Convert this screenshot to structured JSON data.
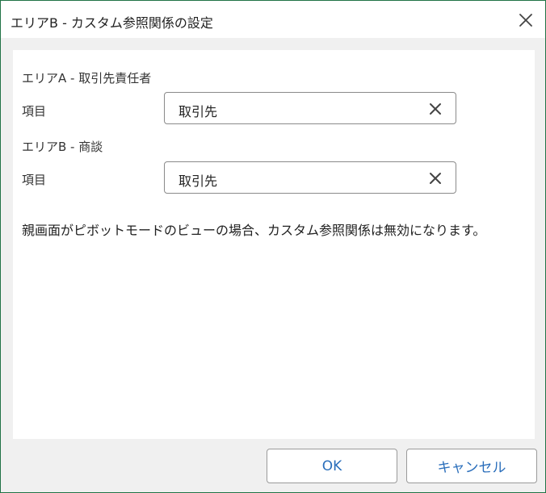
{
  "dialog": {
    "title": "エリアB - カスタム参照関係の設定",
    "close_icon": "close-icon"
  },
  "area_a": {
    "heading": "エリアA - 取引先責任者",
    "field_label": "項目",
    "field_value": "取引先",
    "clear_icon": "clear-icon"
  },
  "area_b": {
    "heading": "エリアB - 商談",
    "field_label": "項目",
    "field_value": "取引先",
    "clear_icon": "clear-icon"
  },
  "note": "親画面がピボットモードのビューの場合、カスタム参照関係は無効になります。",
  "buttons": {
    "ok": "OK",
    "cancel": "キャンセル"
  },
  "colors": {
    "window_border": "#217346",
    "button_text": "#2a6ebb",
    "dialog_background": "#f0f0f0"
  }
}
